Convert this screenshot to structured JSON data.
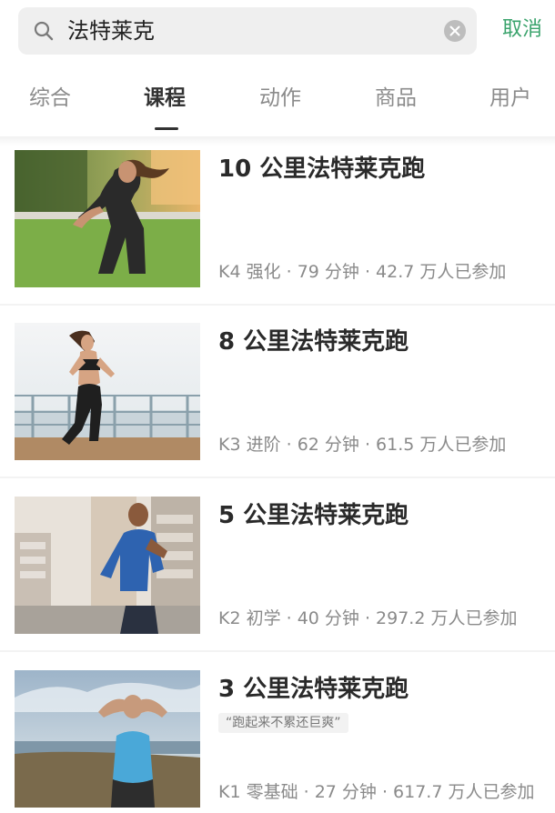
{
  "search": {
    "query": "法特莱克",
    "cancel_label": "取消"
  },
  "tabs": [
    {
      "label": "综合",
      "active": false
    },
    {
      "label": "课程",
      "active": true
    },
    {
      "label": "动作",
      "active": false
    },
    {
      "label": "商品",
      "active": false
    },
    {
      "label": "用户",
      "active": false
    }
  ],
  "courses": [
    {
      "title": "10 公里法特莱克跑",
      "meta": "K4 强化 · 79 分钟 · 42.7 万人已参加",
      "tag": "",
      "image": "woman-running-park-photo"
    },
    {
      "title": "8 公里法特莱克跑",
      "meta": "K3 进阶 · 62 分钟 · 61.5 万人已参加",
      "tag": "",
      "image": "woman-running-boardwalk-photo"
    },
    {
      "title": "5 公里法特莱克跑",
      "meta": "K2 初学 · 40 分钟 · 297.2 万人已参加",
      "tag": "",
      "image": "man-running-city-photo"
    },
    {
      "title": "3 公里法特莱克跑",
      "meta": "K1 零基础 · 27 分钟 · 617.7 万人已参加",
      "tag": "“跑起来不累还巨爽”",
      "image": "woman-stretching-seaside-photo"
    }
  ],
  "colors": {
    "accent": "#3aa36c",
    "tab_active": "#333333",
    "tab_inactive": "#8b8b8b",
    "meta_text": "#8a8a8a"
  }
}
